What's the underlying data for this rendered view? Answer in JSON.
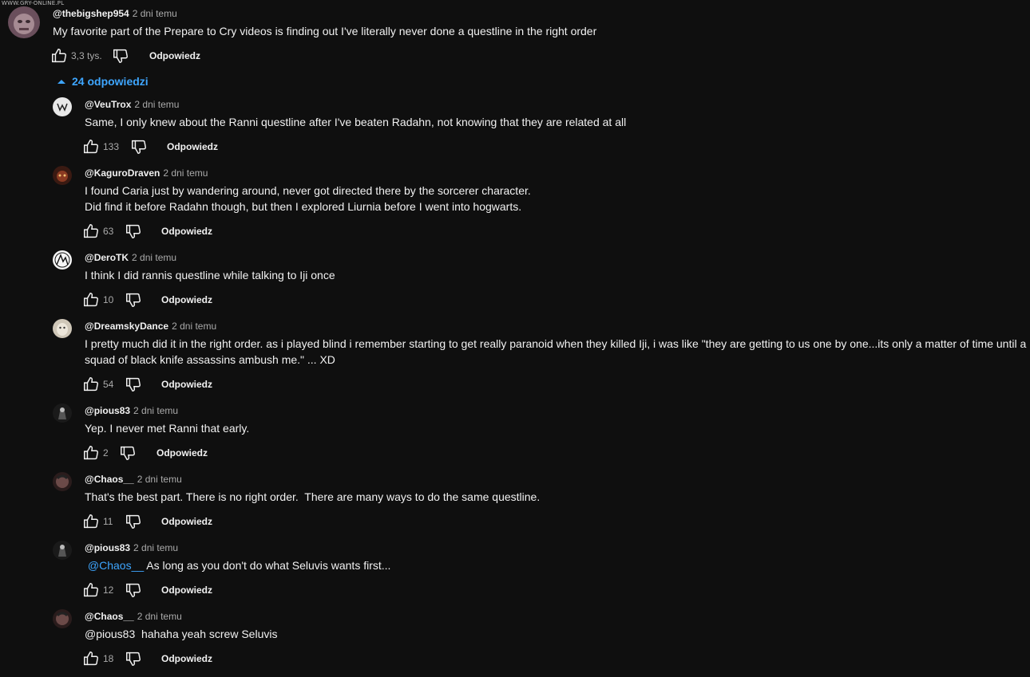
{
  "watermark": "WWW.GRY-ONLINE.PL",
  "reply_label": "Odpowiedz",
  "main_comment": {
    "author": "@thebigshep954",
    "time": "2 dni temu",
    "text": "My favorite part of the Prepare to Cry videos is finding out I've literally never done a questline in the right order",
    "likes": "3,3 tys."
  },
  "replies_toggle": "24 odpowiedzi",
  "replies": [
    {
      "author": "@VeuTrox",
      "time": "2 dni temu",
      "lines": [
        "Same, I only knew about the Ranni questline after I've beaten Radahn, not knowing that they are related at all"
      ],
      "likes": "133"
    },
    {
      "author": "@KaguroDraven",
      "time": "2 dni temu",
      "lines": [
        "I found Caria just by wandering around, never got directed there by the sorcerer character.",
        "Did find it before Radahn though, but then I explored Liurnia before I went into hogwarts."
      ],
      "likes": "63"
    },
    {
      "author": "@DeroTK",
      "time": "2 dni temu",
      "lines": [
        "I think I did rannis questline while talking to Iji once"
      ],
      "likes": "10"
    },
    {
      "author": "@DreamskyDance",
      "time": "2 dni temu",
      "lines": [
        "I pretty much did it in the right order. as i played blind i remember starting to get really paranoid when they killed Iji, i was like \"they are getting to us one by one...its only a matter of time until a",
        "squad of black knife assassins ambush me.\" ... XD"
      ],
      "likes": "54"
    },
    {
      "author": "@pious83",
      "time": "2 dni temu",
      "lines": [
        "Yep. I never met Ranni that early."
      ],
      "likes": "2"
    },
    {
      "author": "@Chaos__",
      "time": "2 dni temu",
      "lines": [
        "That's the best part. There is no right order.  There are many ways to do the same questline."
      ],
      "likes": "11"
    },
    {
      "author": "@pious83",
      "time": "2 dni temu",
      "mention": "@Chaos__",
      "lines": [
        " As long as you don't do what Seluvis wants first..."
      ],
      "likes": "12"
    },
    {
      "author": "@Chaos__",
      "time": "2 dni temu",
      "lines": [
        "@pious83  hahaha yeah screw Seluvis"
      ],
      "likes": "18"
    }
  ]
}
